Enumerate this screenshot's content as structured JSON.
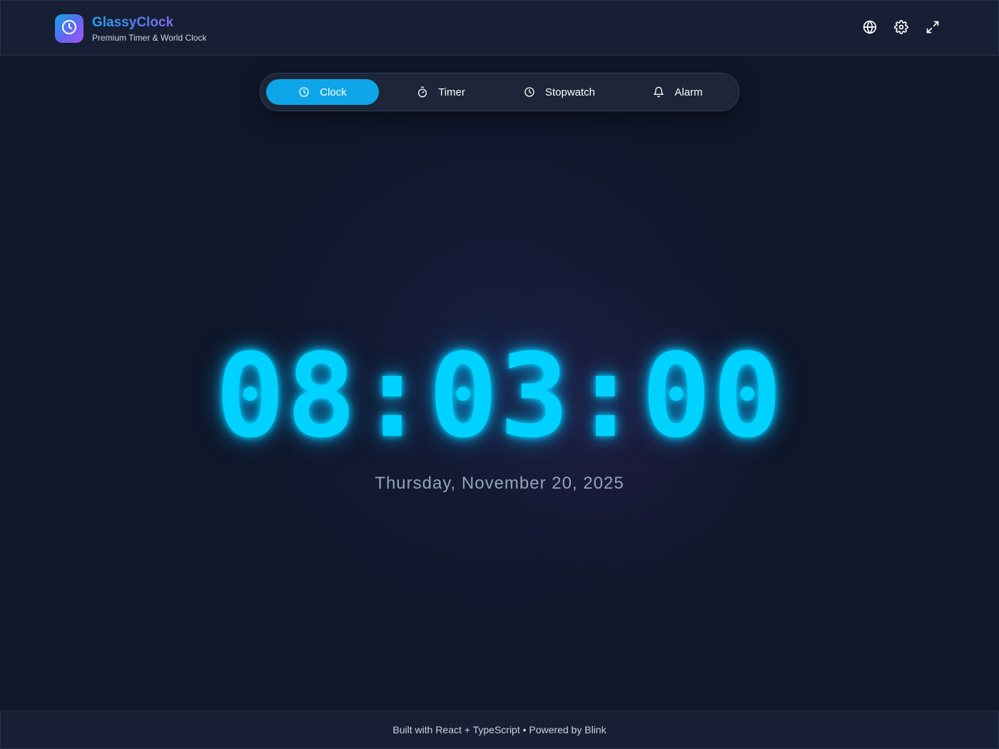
{
  "header": {
    "title": "GlassyClock",
    "subtitle": "Premium Timer & World Clock",
    "logo_icon": "clock-icon",
    "buttons": [
      {
        "name": "world-clock-button",
        "icon": "globe-icon"
      },
      {
        "name": "settings-button",
        "icon": "gear-icon"
      },
      {
        "name": "fullscreen-button",
        "icon": "expand-icon"
      }
    ]
  },
  "tabs": [
    {
      "label": "Clock",
      "icon": "clock-icon",
      "active": true
    },
    {
      "label": "Timer",
      "icon": "stopwatch-icon",
      "active": false
    },
    {
      "label": "Stopwatch",
      "icon": "clock-icon",
      "active": false
    },
    {
      "label": "Alarm",
      "icon": "bell-icon",
      "active": false
    }
  ],
  "clock": {
    "time": "08:03:00",
    "date": "Thursday, November 20, 2025"
  },
  "footer": {
    "text": "Built with React + TypeScript • Powered by Blink"
  },
  "colors": {
    "background": "#0f172a",
    "accent": "#0ea5e9",
    "clock_glow": "#00d2ff",
    "date_text": "#94a3b8"
  }
}
